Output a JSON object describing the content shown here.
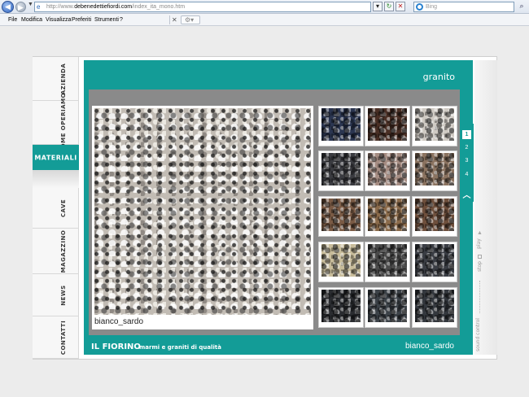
{
  "browser": {
    "url_prefix": "http://www.",
    "url_host": "debenedettiefiordi.com",
    "url_path": "/index_ita_mono.htm",
    "search_placeholder": "Bing",
    "menu": [
      "File",
      "Modifica",
      "Visualizza",
      "Preferiti",
      "Strumenti",
      "?"
    ]
  },
  "nav": {
    "tabs": [
      {
        "label": "AZIENDA",
        "active": false
      },
      {
        "label": "COME OPERIAMO",
        "active": false
      },
      {
        "label": "MATERIALI",
        "active": true
      },
      {
        "label": "CAVE",
        "active": false
      },
      {
        "label": "MAGAZZINO",
        "active": false
      },
      {
        "label": "NEWS",
        "active": false
      },
      {
        "label": "CONTATTI",
        "active": false
      }
    ]
  },
  "gallery": {
    "category": "granito",
    "selected_name": "bianco_sardo",
    "pages": [
      "1",
      "2",
      "3",
      "4"
    ],
    "current_page": "1",
    "thumbnails": [
      {
        "color": "#2a3550"
      },
      {
        "color": "#4a2f25"
      },
      {
        "color": "#cfcac3"
      },
      {
        "color": "#3a3b40"
      },
      {
        "color": "#a58c82"
      },
      {
        "color": "#8b7360"
      },
      {
        "color": "#7a5a44"
      },
      {
        "color": "#8a6a4a"
      },
      {
        "color": "#6e4f3c"
      },
      {
        "color": "#c8bc9a"
      },
      {
        "color": "#4a4a4a"
      },
      {
        "color": "#3a3d44"
      },
      {
        "color": "#2a2c30"
      },
      {
        "color": "#3c4248"
      },
      {
        "color": "#34383e"
      }
    ]
  },
  "controls": {
    "play": "play",
    "stop": "stop",
    "sound": "sound control"
  },
  "footer": {
    "brand": "IL FIORINO",
    "tagline": "marmi e graniti di qualità",
    "selected_name": "bianco_sardo"
  },
  "colors": {
    "accent": "#139c97"
  }
}
